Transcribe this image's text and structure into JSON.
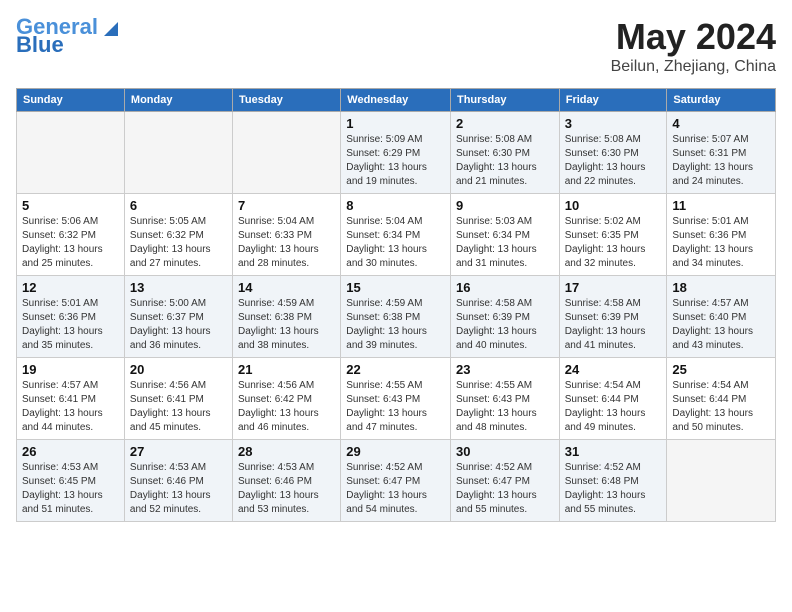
{
  "header": {
    "logo_line1": "General",
    "logo_line2": "Blue",
    "month": "May 2024",
    "location": "Beilun, Zhejiang, China"
  },
  "weekdays": [
    "Sunday",
    "Monday",
    "Tuesday",
    "Wednesday",
    "Thursday",
    "Friday",
    "Saturday"
  ],
  "weeks": [
    [
      {
        "day": "",
        "info": ""
      },
      {
        "day": "",
        "info": ""
      },
      {
        "day": "",
        "info": ""
      },
      {
        "day": "1",
        "info": "Sunrise: 5:09 AM\nSunset: 6:29 PM\nDaylight: 13 hours\nand 19 minutes."
      },
      {
        "day": "2",
        "info": "Sunrise: 5:08 AM\nSunset: 6:30 PM\nDaylight: 13 hours\nand 21 minutes."
      },
      {
        "day": "3",
        "info": "Sunrise: 5:08 AM\nSunset: 6:30 PM\nDaylight: 13 hours\nand 22 minutes."
      },
      {
        "day": "4",
        "info": "Sunrise: 5:07 AM\nSunset: 6:31 PM\nDaylight: 13 hours\nand 24 minutes."
      }
    ],
    [
      {
        "day": "5",
        "info": "Sunrise: 5:06 AM\nSunset: 6:32 PM\nDaylight: 13 hours\nand 25 minutes."
      },
      {
        "day": "6",
        "info": "Sunrise: 5:05 AM\nSunset: 6:32 PM\nDaylight: 13 hours\nand 27 minutes."
      },
      {
        "day": "7",
        "info": "Sunrise: 5:04 AM\nSunset: 6:33 PM\nDaylight: 13 hours\nand 28 minutes."
      },
      {
        "day": "8",
        "info": "Sunrise: 5:04 AM\nSunset: 6:34 PM\nDaylight: 13 hours\nand 30 minutes."
      },
      {
        "day": "9",
        "info": "Sunrise: 5:03 AM\nSunset: 6:34 PM\nDaylight: 13 hours\nand 31 minutes."
      },
      {
        "day": "10",
        "info": "Sunrise: 5:02 AM\nSunset: 6:35 PM\nDaylight: 13 hours\nand 32 minutes."
      },
      {
        "day": "11",
        "info": "Sunrise: 5:01 AM\nSunset: 6:36 PM\nDaylight: 13 hours\nand 34 minutes."
      }
    ],
    [
      {
        "day": "12",
        "info": "Sunrise: 5:01 AM\nSunset: 6:36 PM\nDaylight: 13 hours\nand 35 minutes."
      },
      {
        "day": "13",
        "info": "Sunrise: 5:00 AM\nSunset: 6:37 PM\nDaylight: 13 hours\nand 36 minutes."
      },
      {
        "day": "14",
        "info": "Sunrise: 4:59 AM\nSunset: 6:38 PM\nDaylight: 13 hours\nand 38 minutes."
      },
      {
        "day": "15",
        "info": "Sunrise: 4:59 AM\nSunset: 6:38 PM\nDaylight: 13 hours\nand 39 minutes."
      },
      {
        "day": "16",
        "info": "Sunrise: 4:58 AM\nSunset: 6:39 PM\nDaylight: 13 hours\nand 40 minutes."
      },
      {
        "day": "17",
        "info": "Sunrise: 4:58 AM\nSunset: 6:39 PM\nDaylight: 13 hours\nand 41 minutes."
      },
      {
        "day": "18",
        "info": "Sunrise: 4:57 AM\nSunset: 6:40 PM\nDaylight: 13 hours\nand 43 minutes."
      }
    ],
    [
      {
        "day": "19",
        "info": "Sunrise: 4:57 AM\nSunset: 6:41 PM\nDaylight: 13 hours\nand 44 minutes."
      },
      {
        "day": "20",
        "info": "Sunrise: 4:56 AM\nSunset: 6:41 PM\nDaylight: 13 hours\nand 45 minutes."
      },
      {
        "day": "21",
        "info": "Sunrise: 4:56 AM\nSunset: 6:42 PM\nDaylight: 13 hours\nand 46 minutes."
      },
      {
        "day": "22",
        "info": "Sunrise: 4:55 AM\nSunset: 6:43 PM\nDaylight: 13 hours\nand 47 minutes."
      },
      {
        "day": "23",
        "info": "Sunrise: 4:55 AM\nSunset: 6:43 PM\nDaylight: 13 hours\nand 48 minutes."
      },
      {
        "day": "24",
        "info": "Sunrise: 4:54 AM\nSunset: 6:44 PM\nDaylight: 13 hours\nand 49 minutes."
      },
      {
        "day": "25",
        "info": "Sunrise: 4:54 AM\nSunset: 6:44 PM\nDaylight: 13 hours\nand 50 minutes."
      }
    ],
    [
      {
        "day": "26",
        "info": "Sunrise: 4:53 AM\nSunset: 6:45 PM\nDaylight: 13 hours\nand 51 minutes."
      },
      {
        "day": "27",
        "info": "Sunrise: 4:53 AM\nSunset: 6:46 PM\nDaylight: 13 hours\nand 52 minutes."
      },
      {
        "day": "28",
        "info": "Sunrise: 4:53 AM\nSunset: 6:46 PM\nDaylight: 13 hours\nand 53 minutes."
      },
      {
        "day": "29",
        "info": "Sunrise: 4:52 AM\nSunset: 6:47 PM\nDaylight: 13 hours\nand 54 minutes."
      },
      {
        "day": "30",
        "info": "Sunrise: 4:52 AM\nSunset: 6:47 PM\nDaylight: 13 hours\nand 55 minutes."
      },
      {
        "day": "31",
        "info": "Sunrise: 4:52 AM\nSunset: 6:48 PM\nDaylight: 13 hours\nand 55 minutes."
      },
      {
        "day": "",
        "info": ""
      }
    ]
  ]
}
